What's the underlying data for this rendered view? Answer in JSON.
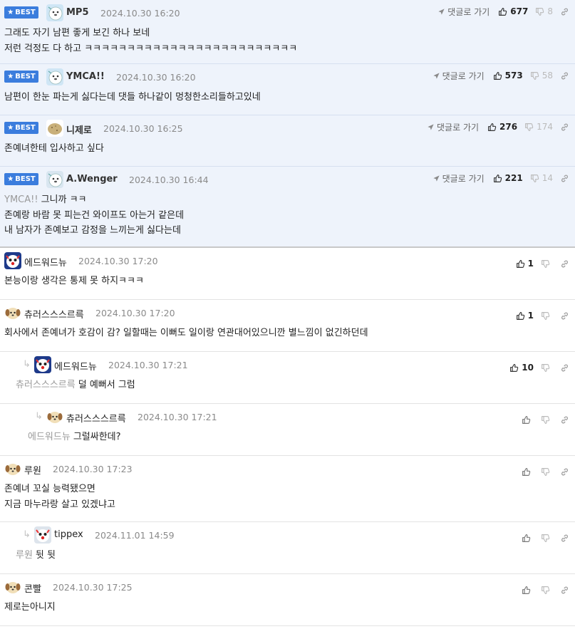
{
  "best_label": "BEST",
  "goto_label": "댓글로 가기",
  "comments": [
    {
      "best": true,
      "avatar": "seal",
      "name": "MP5",
      "date": "2024.10.30 16:20",
      "lines": [
        "그래도 자기 남편 좋게 보긴 하나 보네",
        "저런 걱정도 다 하고 ㅋㅋㅋㅋㅋㅋㅋㅋㅋㅋㅋㅋㅋㅋㅋㅋㅋㅋㅋㅋㅋㅋㅋㅋㅋ"
      ],
      "up": "677",
      "down": "8"
    },
    {
      "best": true,
      "avatar": "seal",
      "name": "YMCA!!",
      "date": "2024.10.30 16:20",
      "lines": [
        "남편이 한눈 파는게 싫다는데 댓들 하나같이 멍청한소리들하고있네"
      ],
      "up": "573",
      "down": "58"
    },
    {
      "best": true,
      "avatar": "potato",
      "name": "니제로",
      "date": "2024.10.30 16:25",
      "lines": [
        "존예녀한테 입사하고 싶다"
      ],
      "up": "276",
      "down": "174"
    },
    {
      "best": true,
      "avatar": "seal2",
      "name": "A.Wenger",
      "date": "2024.10.30 16:44",
      "mention": "YMCA!!",
      "lines": [
        "그니까 ㅋㅋ",
        "존예랑 바람 못 피는건 와이프도 아는거 같은데",
        "내 남자가 존예보고 감정을 느끼는게 싫다는데"
      ],
      "up": "221",
      "down": "14"
    },
    {
      "best": false,
      "avatar": "clown",
      "name": "에드워드뉴",
      "date": "2024.10.30 17:20",
      "lines": [
        "본능이랑 생각은 통제 못 하지ㅋㅋㅋ"
      ],
      "up": "1",
      "down": ""
    },
    {
      "best": false,
      "avatar": "dog",
      "name": "츄러스스스르륵",
      "date": "2024.10.30 17:20",
      "lines": [
        "회사에서 존예녀가 호감이 감? 일할때는 이뻐도 일이랑 연관대어있으니깐 별느낌이 없긴하던데"
      ],
      "up": "1",
      "down": ""
    },
    {
      "best": false,
      "depth": 1,
      "avatar": "clown",
      "name": "에드워드뉴",
      "date": "2024.10.30 17:21",
      "mention": "츄러스스스르륵",
      "lines": [
        "덜 예뻐서 그럼"
      ],
      "up": "10",
      "down": ""
    },
    {
      "best": false,
      "depth": 2,
      "avatar": "dog",
      "name": "츄러스스스르륵",
      "date": "2024.10.30 17:21",
      "mention": "에드워드뉴",
      "lines": [
        "그럴싸한데?"
      ],
      "up": "",
      "down": ""
    },
    {
      "best": false,
      "avatar": "dog",
      "name": "루원",
      "date": "2024.10.30 17:23",
      "lines": [
        "존예녀 꼬실 능력됐으면",
        "지금 마누라랑 살고 있겠냐고"
      ],
      "up": "",
      "down": ""
    },
    {
      "best": false,
      "depth": 1,
      "avatar": "clown2",
      "name": "tippex",
      "date": "2024.11.01 14:59",
      "mention": "루원",
      "lines": [
        "뒷 뒷"
      ],
      "up": "",
      "down": ""
    },
    {
      "best": false,
      "avatar": "dog",
      "name": "콘빨",
      "date": "2024.10.30 17:25",
      "lines": [
        "제로는아니지"
      ],
      "up": "",
      "down": ""
    }
  ]
}
